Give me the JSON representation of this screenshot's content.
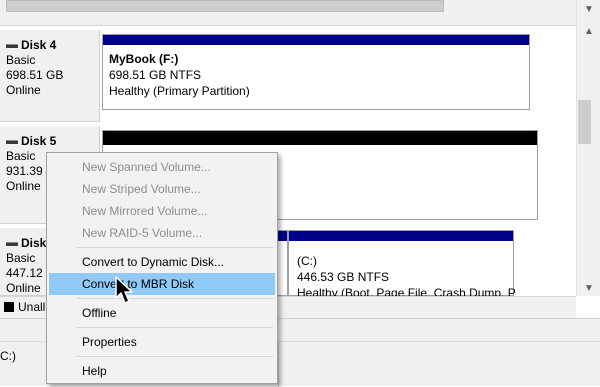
{
  "disks": [
    {
      "name": "Disk 4",
      "type": "Basic",
      "size": "698.51 GB",
      "status": "Online",
      "volume": {
        "name": "MyBook  (F:)",
        "size_fs": "698.51 GB NTFS",
        "health": "Healthy (Primary Partition)",
        "bar_color": "#00008b"
      }
    },
    {
      "name": "Disk 5",
      "type": "Basic",
      "size": "931.39 G",
      "status": "Online",
      "volume": {
        "bar_color": "#000000"
      }
    },
    {
      "name": "Disk",
      "type": "Basic",
      "size": "447.12 G",
      "status": "Online",
      "volume": {
        "name": "(C:)",
        "size_fs": "446.53 GB NTFS",
        "health": "Healthy (Boot, Page File, Crash Dump, P",
        "bar_color": "#00008b"
      }
    }
  ],
  "legend": {
    "unallocated_label": "Unall"
  },
  "status": {
    "drive": "C:)"
  },
  "context_menu": {
    "items": [
      {
        "label": "New Spanned Volume...",
        "enabled": false
      },
      {
        "label": "New Striped Volume...",
        "enabled": false
      },
      {
        "label": "New Mirrored Volume...",
        "enabled": false
      },
      {
        "label": "New RAID-5 Volume...",
        "enabled": false
      },
      {
        "label": "Convert to Dynamic Disk...",
        "enabled": true
      },
      {
        "label": "Convert to MBR Disk",
        "enabled": true,
        "highlighted": true
      },
      {
        "label": "Offline",
        "enabled": true
      },
      {
        "label": "Properties",
        "enabled": true
      },
      {
        "label": "Help",
        "enabled": true
      }
    ]
  },
  "colors": {
    "primary_partition_bar": "#00008b",
    "unallocated_bar": "#000000",
    "menu_highlight": "#91c9f7"
  },
  "icons": [
    "disk-icon",
    "scroll-up-icon",
    "scroll-down-icon",
    "mouse-cursor-icon"
  ]
}
